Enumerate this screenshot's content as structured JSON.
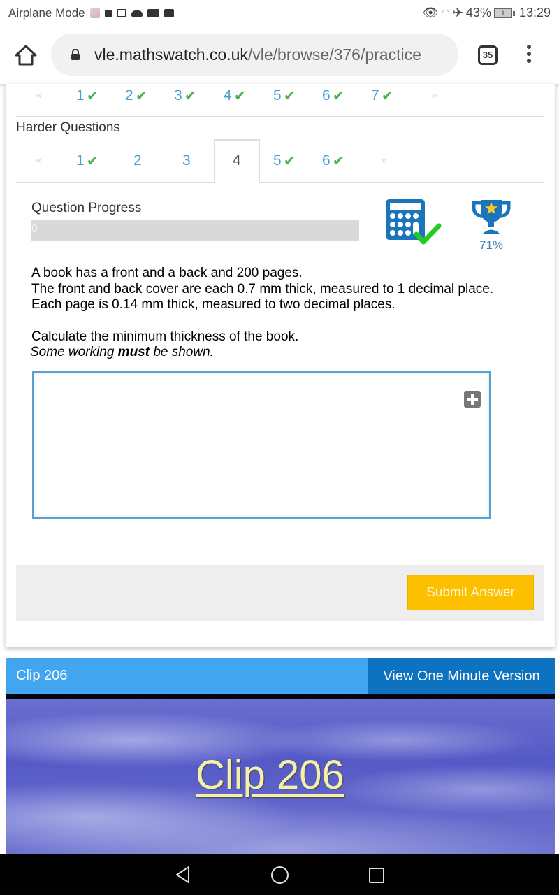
{
  "status_bar": {
    "mode_label": "Airplane Mode",
    "battery_pct": "43%",
    "time": "13:29",
    "left_icons": [
      "app-icon",
      "facebook-icon",
      "calendar-icon",
      "cloud-icon",
      "youtube-icon",
      "plus-box-icon"
    ],
    "right_icons": [
      "eye-icon",
      "wifi-icon",
      "airplane-icon",
      "battery-icon"
    ]
  },
  "browser": {
    "url_domain": "vle.mathswatch.co.uk",
    "url_path": "/vle/browse/376/practice",
    "tab_count": "35"
  },
  "previous_pager": {
    "prev_arrow": "«",
    "next_arrow": "»",
    "items": [
      {
        "label": "1",
        "done": true
      },
      {
        "label": "2",
        "done": true
      },
      {
        "label": "3",
        "done": true
      },
      {
        "label": "4",
        "done": true
      },
      {
        "label": "5",
        "done": true
      },
      {
        "label": "6",
        "done": true
      },
      {
        "label": "7",
        "done": true
      }
    ]
  },
  "harder": {
    "title": "Harder Questions",
    "prev_arrow": "«",
    "next_arrow": "»",
    "active": "4",
    "items": [
      {
        "label": "1",
        "done": true
      },
      {
        "label": "2",
        "done": false
      },
      {
        "label": "3",
        "done": false
      },
      {
        "label": "4",
        "done": false,
        "active": true
      },
      {
        "label": "5",
        "done": true
      },
      {
        "label": "6",
        "done": true
      }
    ]
  },
  "check_glyph": "✔",
  "progress": {
    "label": "Question Progress",
    "value": 0,
    "value_text": "0"
  },
  "trophy": {
    "percent": "71%"
  },
  "question": {
    "lines": [
      "A book has a front and a back and 200 pages.",
      "The front and back cover are each 0.7 mm thick, measured to 1 decimal place.",
      "Each page is 0.14 mm thick, measured to two decimal places."
    ],
    "task": "Calculate the minimum thickness of the book.",
    "note_before": "Some working ",
    "note_bold": "must",
    "note_after": " be shown."
  },
  "answer": {
    "value": ""
  },
  "submit_label": "Submit Answer",
  "clip": {
    "title": "Clip 206",
    "one_minute_label": "View One Minute Version",
    "video_title": "Clip 206"
  },
  "colors": {
    "link_blue": "#4a9fd0",
    "check_green": "#4caf50",
    "submit_yellow": "#fcc000",
    "clip_header_blue": "#42a5ef",
    "clip_button_blue": "#0d72c0"
  }
}
